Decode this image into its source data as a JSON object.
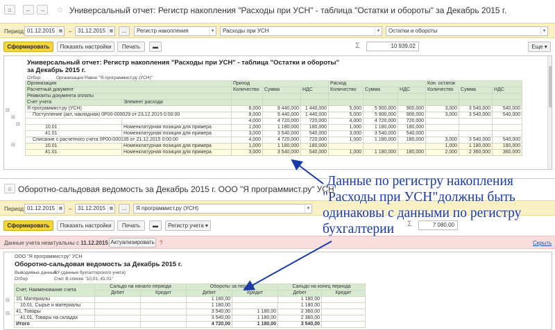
{
  "window1": {
    "title": "Универсальный отчет: Регистр накопления \"Расходы при УСН\" - таблица \"Остатки и обороты\" за Декабрь 2015 г.",
    "period_label": "Период:",
    "date_from": "01.12.2015",
    "date_sep": "–",
    "date_to": "31.12.2015",
    "dots": "...",
    "source_type": "Регистр накопления",
    "source": "Расходы при УСН",
    "table_kind": "Остатки и обороты",
    "generate_btn": "Сформировать",
    "settings_btn": "Показать настройки",
    "print_btn": "Печать",
    "sigma": "Σ",
    "sum_value": "10 939,02",
    "more_btn": "Еще",
    "report": {
      "title_line1": "Универсальный отчет: Регистр накопления \"Расходы при УСН\" - таблица \"Остатки и обороты\"",
      "title_line2": "за Декабрь 2015 г.",
      "filter_label": "Отбор:",
      "filter_value": "Организация Равно \"Я программист.ру (УСН)\"",
      "header_rows": [
        [
          "Организация",
          "Приход",
          "Расход",
          "Кон. остаток"
        ],
        [
          "Расчетный документ",
          "Количество",
          "Сумма",
          "НДС",
          "Количество",
          "Сумма",
          "НДС",
          "Количество",
          "Сумма",
          "НДС"
        ],
        [
          "Реквизиты документа оплаты"
        ],
        [
          "Счет учета",
          "Элемент расхода"
        ]
      ],
      "rows": [
        [
          "Я программист.ру (УСН)",
          "",
          "8,000",
          "9 440,000",
          "1 440,000",
          "5,000",
          "5 900,000",
          "900,000",
          "3,000",
          "3 540,000",
          "540,000"
        ],
        [
          "Поступление (акт, накладная) 0Р00-000029 от 23.12.2015 0:00:00",
          "",
          "8,000",
          "9 440,000",
          "1 440,000",
          "5,000",
          "5 900,000",
          "900,000",
          "3,000",
          "3 540,000",
          "540,000"
        ],
        [
          "",
          "",
          "4,000",
          "4 720,000",
          "720,000",
          "4,000",
          "4 720,000",
          "720,000",
          "",
          "",
          ""
        ],
        [
          "10.01",
          "Номенклатурная позиция для примера",
          "1,000",
          "1 180,000",
          "180,000",
          "1,000",
          "1 180,000",
          "180,000",
          "",
          "",
          ""
        ],
        [
          "41.01",
          "Номенклатурная позиция для примера",
          "3,000",
          "3 540,000",
          "540,000",
          "3,000",
          "3 540,000",
          "540,000",
          "",
          "",
          ""
        ],
        [
          "Списание с расчетного счета 0Р00-000135 от 21.12.2015 0:00:00",
          "",
          "4,000",
          "4 720,000",
          "720,000",
          "1,000",
          "1 180,000",
          "180,000",
          "3,000",
          "3 540,000",
          "540,000"
        ],
        [
          "10.01",
          "Номенклатурная позиция для примера",
          "1,000",
          "1 180,000",
          "180,000",
          "",
          "",
          "",
          "1,000",
          "1 180,000",
          "180,000"
        ],
        [
          "41.01",
          "Номенклатурная позиция для примера",
          "3,000",
          "3 540,000",
          "540,000",
          "1,000",
          "1 180,000",
          "180,000",
          "2,000",
          "2 360,000",
          "360,000"
        ]
      ]
    }
  },
  "window2": {
    "title": "Оборотно-сальдовая ведомость за Декабрь 2015 г. ООО \"Я программист.ру\" УСН",
    "period_label": "Период:",
    "date_from": "01.12.2015",
    "date_sep": "–",
    "date_to": "31.12.2015",
    "dots": "...",
    "org": "Я программист.ру (УСН)",
    "generate_btn": "Сформировать",
    "settings_btn": "Показать настройки",
    "print_btn": "Печать",
    "reg_btn": "Регистр учета",
    "sigma": "Σ",
    "sum_value": "7 080,00",
    "warning_text": "Данные учета неактуальны с",
    "warning_date": "11.12.2015",
    "actualize_btn": "Актуализировать",
    "help": "?",
    "hide_link": "Скрыть",
    "report": {
      "company": "ООО \"Я программист.ру\" УСН",
      "title": "Оборотно-сальдовая ведомость за Декабрь 2015 г.",
      "output_label": "Выводимые данные:",
      "output_value": "БУ (данные бухгалтерского учета)",
      "filter_label": "Отбор",
      "filter_value": "Счет В списке \"10.01; 41.01\"",
      "header_top": [
        "Счет, Наименование счета",
        "Сальдо на начало периода",
        "Обороты за период",
        "Сальдо на конец периода"
      ],
      "header_sub": [
        "Дебет",
        "Кредит",
        "Дебет",
        "Кредит",
        "Дебет",
        "Кредит"
      ],
      "rows": [
        [
          "10, Материалы",
          "",
          "",
          "1 180,00",
          "",
          "1 180,00",
          ""
        ],
        [
          "10.01, Сырье и материалы",
          "",
          "",
          "1 180,00",
          "",
          "1 180,00",
          ""
        ],
        [
          "41, Товары",
          "",
          "",
          "3 540,00",
          "1 180,00",
          "2 360,00",
          ""
        ],
        [
          "41.01, Товары на складах",
          "",
          "",
          "3 540,00",
          "1 180,00",
          "2 360,00",
          ""
        ],
        [
          "Итого",
          "",
          "",
          "4 720,00",
          "1 180,00",
          "3 540,00",
          ""
        ]
      ]
    }
  },
  "annotation": {
    "lines": [
      "Данные по регистру накопления",
      "\"Расходы при УСН\"должны быть",
      "одинаковы с данными по регистру",
      "бухгалтерии"
    ],
    "color": "#1a3aa8"
  },
  "icons": [
    "home-icon",
    "back-icon",
    "forward-icon",
    "star-icon",
    "calendar-icon",
    "sigma-icon"
  ]
}
